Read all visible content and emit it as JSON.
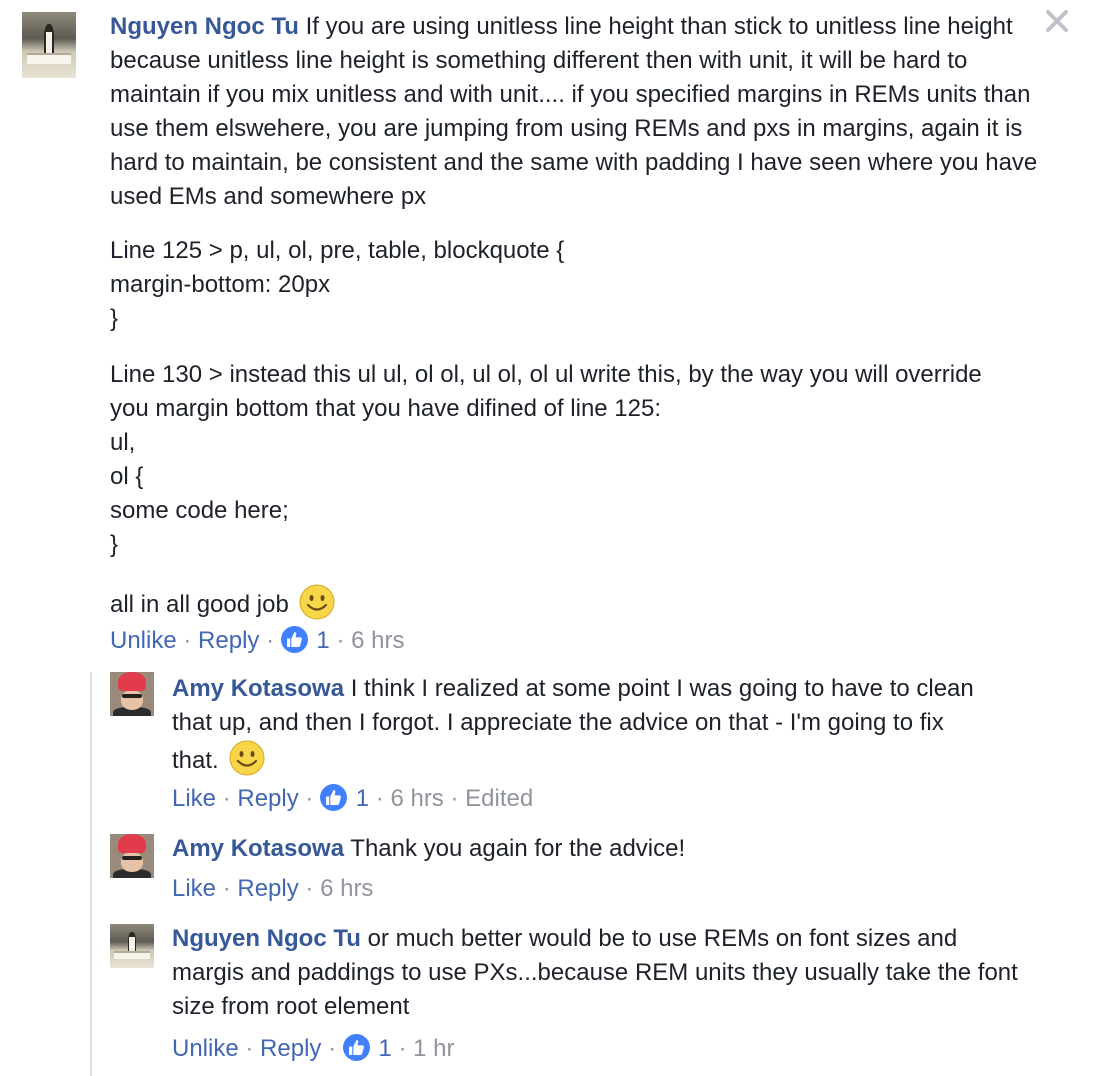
{
  "comments": [
    {
      "author": "Nguyen Ngoc Tu",
      "body": "If you are using unitless line height than stick to unitless line height because unitless line height is something different then with unit, it will be hard to maintain if you mix unitless and with unit.... if you specified margins in REMs units than use them elswehere, you are jumping from using REMs and pxs in margins, again it is hard to maintain, be consistent and the same with padding I have seen where you have used EMs and somewhere px",
      "code_block_1": [
        "Line 125 > p, ul, ol, pre, table, blockquote {",
        "margin-bottom: 20px",
        "}"
      ],
      "code_block_2": [
        "Line 130 > instead this ul ul, ol ol, ul ol, ol ul write this, by the way you will override you margin bottom that you have difined of line 125:",
        "ul,",
        "ol {",
        "some code here;",
        "}"
      ],
      "closing": "all in all good job",
      "actions": {
        "unlike": "Unlike",
        "reply": "Reply",
        "likes": "1",
        "time": "6 hrs"
      }
    },
    {
      "author": "Amy Kotasowa",
      "body": "I think I realized at some point I was going to have to clean that up, and then I forgot. I appreciate the advice on that - I'm going to fix that.",
      "actions": {
        "like": "Like",
        "reply": "Reply",
        "likes": "1",
        "time": "6 hrs",
        "edited": "Edited"
      }
    },
    {
      "author": "Amy Kotasowa",
      "body": "Thank you again for the advice!",
      "actions": {
        "like": "Like",
        "reply": "Reply",
        "time": "6 hrs"
      }
    },
    {
      "author": "Nguyen Ngoc Tu",
      "body": "or much better would be to use REMs on font sizes and margis and paddings to use PXs...because REM units they usually take the font size from root element",
      "actions": {
        "unlike": "Unlike",
        "reply": "Reply",
        "likes": "1",
        "time": "1 hr"
      }
    }
  ],
  "separator": "·",
  "icons": {
    "close": "close-icon",
    "like": "thumbs-up-icon",
    "emoji": "smiley-emoji-icon"
  },
  "colors": {
    "author": "#365899",
    "link": "#4267b2",
    "meta": "#90949c",
    "like_badge": "#4080ff"
  }
}
